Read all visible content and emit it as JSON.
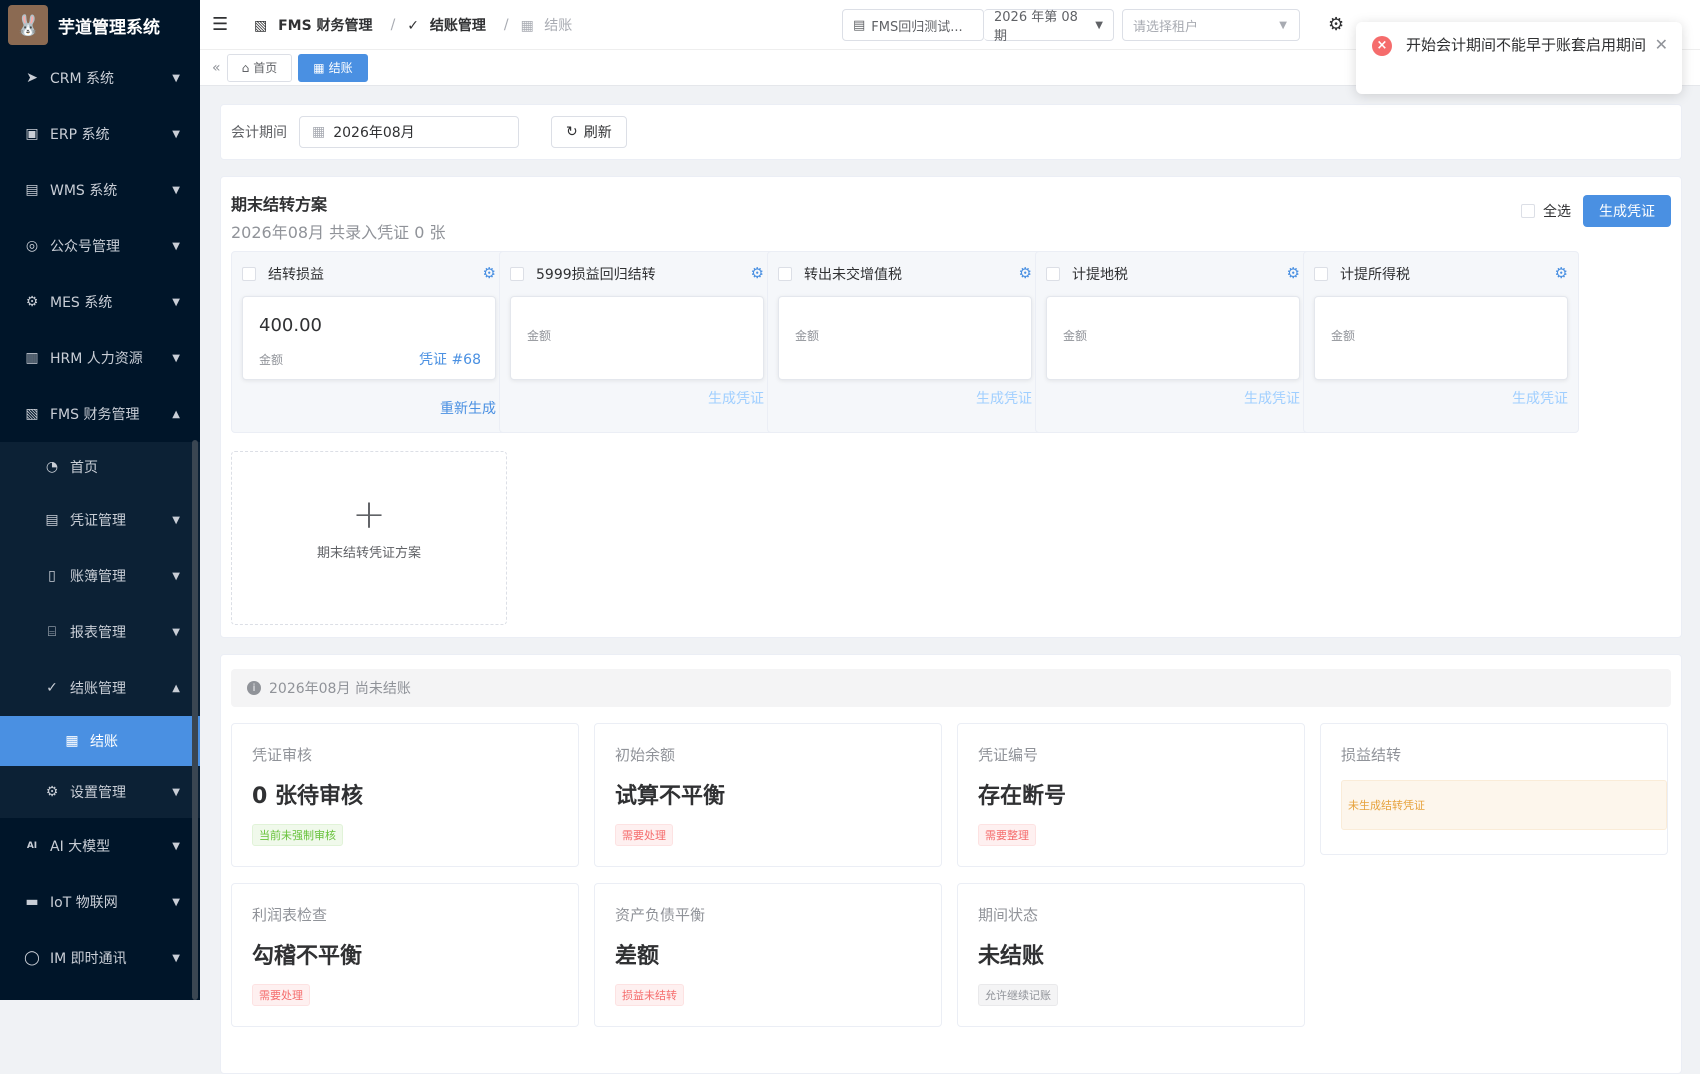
{
  "app": {
    "title": "芋道管理系统"
  },
  "sidebar": {
    "items": [
      {
        "label": "CRM 系统",
        "icon": "send-icon"
      },
      {
        "label": "ERP 系统",
        "icon": "erp-icon"
      },
      {
        "label": "WMS 系统",
        "icon": "package-icon"
      },
      {
        "label": "公众号管理",
        "icon": "compass-icon"
      },
      {
        "label": "MES 系统",
        "icon": "chip-icon"
      },
      {
        "label": "HRM 人力资源",
        "icon": "building-icon"
      },
      {
        "label": "FMS 财务管理",
        "icon": "finance-icon"
      }
    ],
    "fms_sub": [
      {
        "label": "首页",
        "icon": "dashboard-icon"
      },
      {
        "label": "凭证管理",
        "icon": "document-icon"
      },
      {
        "label": "账簿管理",
        "icon": "book-icon"
      },
      {
        "label": "报表管理",
        "icon": "report-icon"
      },
      {
        "label": "结账管理",
        "icon": "check-circle-icon"
      }
    ],
    "closing_sub": [
      {
        "label": "结账",
        "icon": "calendar-icon"
      }
    ],
    "settings": {
      "label": "设置管理",
      "icon": "gear-icon"
    },
    "bottom": [
      {
        "label": "AI 大模型",
        "icon": "ai-icon"
      },
      {
        "label": "IoT 物联网",
        "icon": "iot-icon"
      },
      {
        "label": "IM 即时通讯",
        "icon": "chat-icon"
      }
    ]
  },
  "header": {
    "breadcrumb": [
      "FMS 财务管理",
      "结账管理",
      "结账"
    ],
    "ledger_select": "FMS回归测试...",
    "period_select": "2026 年第 08 期",
    "tenant_placeholder": "请选择租户"
  },
  "tabs": [
    {
      "label": "首页"
    },
    {
      "label": "结账"
    }
  ],
  "filter": {
    "label": "会计期间",
    "date": "2026年08月",
    "refresh": "刷新"
  },
  "plan": {
    "title": "期末结转方案",
    "subtitle": "2026年08月 共录入凭证 0 张",
    "select_all": "全选",
    "generate": "生成凭证",
    "cards": [
      {
        "title": "结转损益",
        "amount": "400.00",
        "amount_label": "金额",
        "voucher": "凭证 #68",
        "action": "重新生成"
      },
      {
        "title": "5999损益回归结转",
        "amount_label": "金额",
        "action": "生成凭证"
      },
      {
        "title": "转出未交增值税",
        "amount_label": "金额",
        "action": "生成凭证"
      },
      {
        "title": "计提地税",
        "amount_label": "金额",
        "action": "生成凭证"
      },
      {
        "title": "计提所得税",
        "amount_label": "金额",
        "action": "生成凭证"
      }
    ],
    "add_label": "期末结转凭证方案"
  },
  "status": {
    "alert": "2026年08月 尚未结账",
    "items": [
      {
        "label": "凭证审核",
        "value": "0 张待审核",
        "badge": "当前未强制审核",
        "color": "green"
      },
      {
        "label": "初始余额",
        "value": "试算不平衡",
        "badge": "需要处理",
        "color": "red"
      },
      {
        "label": "凭证编号",
        "value": "存在断号",
        "badge": "需要整理",
        "color": "red"
      },
      {
        "label": "损益结转",
        "value": "",
        "badge": "未生成结转凭证",
        "color": "orange"
      },
      {
        "label": "利润表检查",
        "value": "勾稽不平衡",
        "badge": "需要处理",
        "color": "red"
      },
      {
        "label": "资产负债平衡",
        "value": "差额",
        "badge": "损益未结转",
        "color": "red"
      },
      {
        "label": "期间状态",
        "value": "未结账",
        "badge": "允许继续记账",
        "color": "gray"
      }
    ]
  },
  "toast": {
    "message": "开始会计期间不能早于账套启用期间"
  },
  "colors": {
    "primary": "#4a90e2",
    "sidebar": "#001529",
    "danger": "#f56c6c"
  }
}
